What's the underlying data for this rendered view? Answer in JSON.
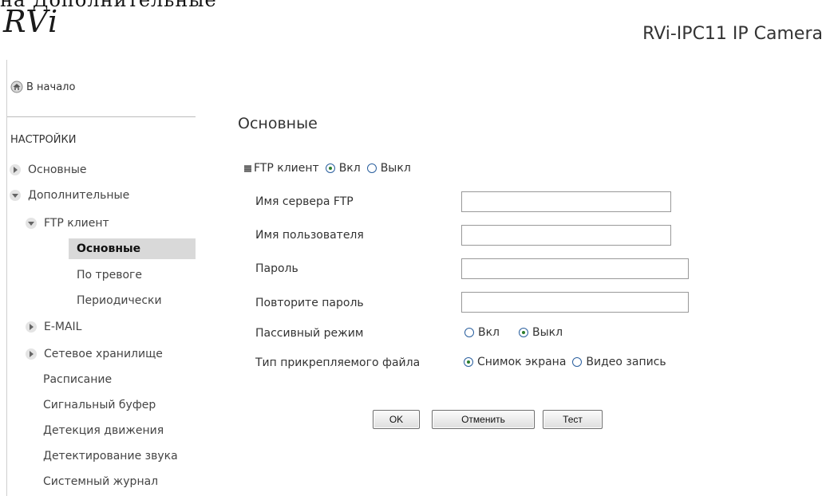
{
  "overlay_text": "на Дополнительные",
  "header": {
    "logo_text": "RVi",
    "product_title": "RVi-IPC11 IP Camera"
  },
  "sidebar": {
    "home_label": "В начало",
    "section_header": "НАСТРОЙКИ",
    "items": [
      {
        "label": "Основные",
        "level": 1,
        "arrow": "right"
      },
      {
        "label": "Дополнительные",
        "level": 1,
        "arrow": "down"
      },
      {
        "label": "FTP клиент",
        "level": 2,
        "arrow": "down"
      },
      {
        "label": "Основные",
        "level": 3,
        "active": true
      },
      {
        "label": "По тревоге",
        "level": 3
      },
      {
        "label": "Периодически",
        "level": 3
      },
      {
        "label": "E-MAIL",
        "level": 2,
        "arrow": "right"
      },
      {
        "label": "Сетевое хранилище",
        "level": 2,
        "arrow": "right"
      },
      {
        "label": "Расписание",
        "level": 2
      },
      {
        "label": "Сигнальный буфер",
        "level": 2
      },
      {
        "label": "Детекция движения",
        "level": 2
      },
      {
        "label": "Детектирование звука",
        "level": 2
      },
      {
        "label": "Системный журнал",
        "level": 2
      }
    ]
  },
  "main": {
    "title": "Основные",
    "ftp_client": {
      "label": "FTP клиент",
      "on_label": "Вкл",
      "off_label": "Выкл",
      "selected": "on"
    },
    "fields": {
      "server_label": "Имя сервера FTP",
      "server_value": "",
      "user_label": "Имя пользователя",
      "user_value": "",
      "password_label": "Пароль",
      "password_value": "",
      "repeat_password_label": "Повторите пароль",
      "repeat_password_value": ""
    },
    "passive_mode": {
      "label": "Пассивный режим",
      "on_label": "Вкл",
      "off_label": "Выкл",
      "selected": "off"
    },
    "attachment_type": {
      "label": "Тип прикрепляемого файла",
      "snapshot_label": "Снимок экрана",
      "video_label": "Видео запись",
      "selected": "snapshot"
    },
    "buttons": {
      "ok_label": "OK",
      "cancel_label": "Отменить",
      "test_label": "Тест"
    }
  },
  "colors": {
    "active_item_bg": "#d9d9d9",
    "radio_border": "#2a5f9e",
    "radio_dot": "#2c7d2c"
  }
}
